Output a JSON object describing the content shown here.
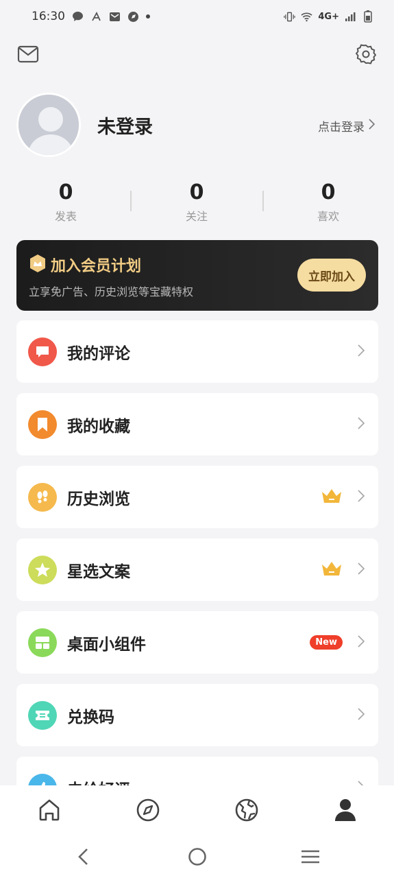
{
  "status_bar": {
    "time": "16:30",
    "network": "4G+"
  },
  "profile": {
    "name": "未登录",
    "login_link": "点击登录"
  },
  "stats": [
    {
      "value": "0",
      "label": "发表"
    },
    {
      "value": "0",
      "label": "关注"
    },
    {
      "value": "0",
      "label": "喜欢"
    }
  ],
  "vip": {
    "title": "加入会员计划",
    "subtitle": "立享免广告、历史浏览等宝藏特权",
    "button": "立即加入"
  },
  "menu": [
    {
      "label": "我的评论",
      "icon": "comment-icon",
      "color": "#f0584a"
    },
    {
      "label": "我的收藏",
      "icon": "bookmark-icon",
      "color": "#f28a2e"
    },
    {
      "label": "历史浏览",
      "icon": "footprint-icon",
      "color": "#f5b94d",
      "badge": "crown"
    },
    {
      "label": "星选文案",
      "icon": "star-icon",
      "color": "#cddc5a",
      "badge": "crown"
    },
    {
      "label": "桌面小组件",
      "icon": "widget-icon",
      "color": "#8bd95a",
      "badge_text": "New"
    },
    {
      "label": "兑换码",
      "icon": "ticket-icon",
      "color": "#4fd6b6"
    },
    {
      "label": "去给好评",
      "icon": "thumb-icon",
      "color": "#4ab7ea"
    }
  ],
  "colors": {
    "accent_gold": "#f1cc84",
    "crown": "#f2b63a",
    "new_badge": "#ef3e2a"
  }
}
